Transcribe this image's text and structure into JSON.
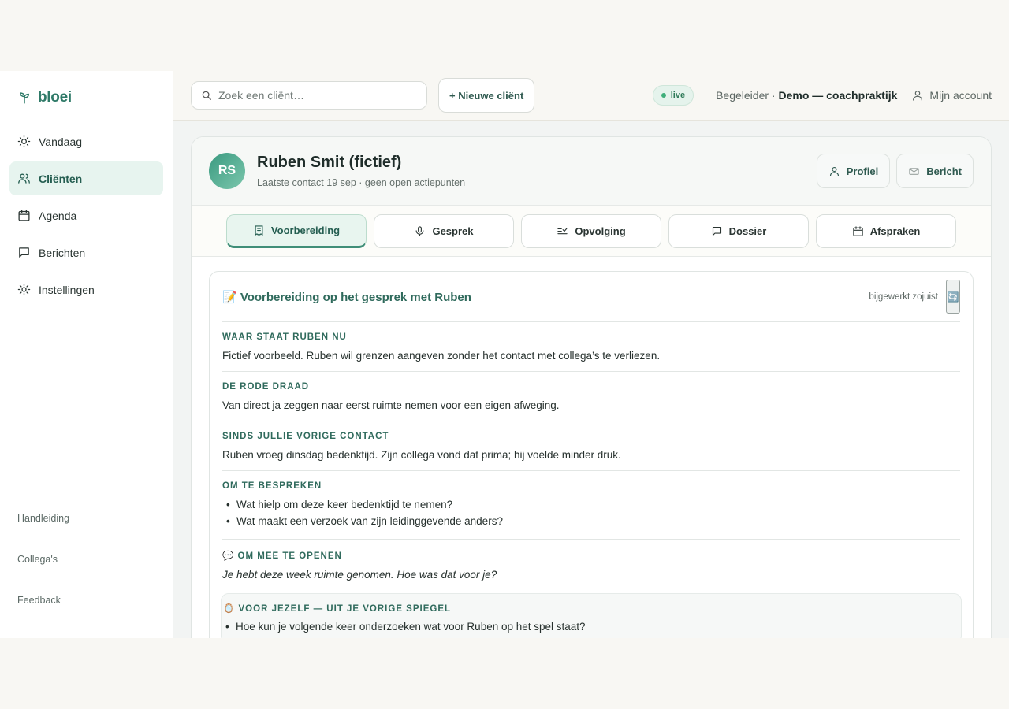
{
  "app": {
    "name": "bloei"
  },
  "sidebar": {
    "items": [
      {
        "label": "Vandaag"
      },
      {
        "label": "Cliënten"
      },
      {
        "label": "Agenda"
      },
      {
        "label": "Berichten"
      },
      {
        "label": "Instellingen"
      }
    ],
    "bottom": [
      {
        "label": "Handleiding"
      },
      {
        "label": "Collega's"
      },
      {
        "label": "Feedback"
      }
    ]
  },
  "topbar": {
    "search_placeholder": "Zoek een cliënt…",
    "new_client": "+ Nieuwe cliënt",
    "live": "live",
    "role": "Begeleider",
    "separator": " · ",
    "org": "Demo — coachpraktijk",
    "account": "Mijn account"
  },
  "client": {
    "initials": "RS",
    "name": "Ruben Smit (fictief)",
    "subtitle": "Laatste contact 19 sep · geen open actiepunten",
    "profile_button": "Profiel",
    "message_button": "Bericht"
  },
  "tabs": [
    {
      "label": "Voorbereiding"
    },
    {
      "label": "Gesprek"
    },
    {
      "label": "Opvolging"
    },
    {
      "label": "Dossier"
    },
    {
      "label": "Afspraken"
    }
  ],
  "prep": {
    "title": "📝 Voorbereiding op het gesprek met Ruben",
    "updated": "bijgewerkt zojuist",
    "sections": [
      {
        "label": "WAAR STAAT RUBEN NU",
        "text": "Fictief voorbeeld. Ruben wil grenzen aangeven zonder het contact met collega’s te verliezen."
      },
      {
        "label": "DE RODE DRAAD",
        "text": "Van direct ja zeggen naar eerst ruimte nemen voor een eigen afweging."
      },
      {
        "label": "SINDS JULLIE VORIGE CONTACT",
        "text": "Ruben vroeg dinsdag bedenktijd. Zijn collega vond dat prima; hij voelde minder druk."
      }
    ],
    "discuss": {
      "label": "OM TE BESPREKEN",
      "items": [
        "Wat hielp om deze keer bedenktijd te nemen?",
        "Wat maakt een verzoek van zijn leidinggevende anders?"
      ]
    },
    "opener": {
      "label": "💬 OM MEE TE OPENEN",
      "text": "Je hebt deze week ruimte genomen. Hoe was dat voor je?"
    },
    "mirror": {
      "label": "🪞 VOOR JEZELF — UIT JE VORIGE SPIEGEL",
      "items": [
        "Hoe kun je volgende keer onderzoeken wat voor Ruben op het spel staat?"
      ]
    }
  },
  "colors": {
    "accent": "#2f7a68",
    "active_bg": "#e7f4ef",
    "live_dot": "#3fae7a"
  }
}
